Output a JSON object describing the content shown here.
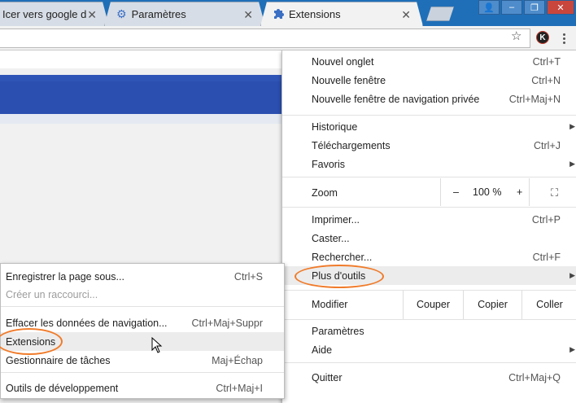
{
  "tabs": [
    {
      "title": "Icer vers google d",
      "icon": "page-icon"
    },
    {
      "title": "Paramètres",
      "icon": "gear-icon"
    },
    {
      "title": "Extensions",
      "icon": "puzzle-icon"
    }
  ],
  "toolbar": {
    "avatar_letter": "K"
  },
  "menu": {
    "new_tab": {
      "label": "Nouvel onglet",
      "shortcut": "Ctrl+T"
    },
    "new_window": {
      "label": "Nouvelle fenêtre",
      "shortcut": "Ctrl+N"
    },
    "incognito": {
      "label": "Nouvelle fenêtre de navigation privée",
      "shortcut": "Ctrl+Maj+N"
    },
    "history": {
      "label": "Historique"
    },
    "downloads": {
      "label": "Téléchargements",
      "shortcut": "Ctrl+J"
    },
    "bookmarks": {
      "label": "Favoris"
    },
    "zoom": {
      "label": "Zoom",
      "minus": "–",
      "value": "100 %",
      "plus": "+"
    },
    "print": {
      "label": "Imprimer...",
      "shortcut": "Ctrl+P"
    },
    "cast": {
      "label": "Caster..."
    },
    "find": {
      "label": "Rechercher...",
      "shortcut": "Ctrl+F"
    },
    "more_tools": {
      "label": "Plus d'outils"
    },
    "edit": {
      "label": "Modifier",
      "cut": "Couper",
      "copy": "Copier",
      "paste": "Coller"
    },
    "settings": {
      "label": "Paramètres"
    },
    "help": {
      "label": "Aide"
    },
    "quit": {
      "label": "Quitter",
      "shortcut": "Ctrl+Maj+Q"
    }
  },
  "submenu": {
    "save_page": {
      "label": "Enregistrer la page sous...",
      "shortcut": "Ctrl+S"
    },
    "create_shortcut": {
      "label": "Créer un raccourci..."
    },
    "clear_data": {
      "label": "Effacer les données de navigation...",
      "shortcut": "Ctrl+Maj+Suppr"
    },
    "extensions": {
      "label": "Extensions"
    },
    "task_manager": {
      "label": "Gestionnaire de tâches",
      "shortcut": "Maj+Échap"
    },
    "dev_tools": {
      "label": "Outils de développement",
      "shortcut": "Ctrl+Maj+I"
    }
  },
  "colors": {
    "highlight_oval": "#f07b2a",
    "tab_strip": "#1f6fb8",
    "page_banner": "#2a4fb0"
  }
}
